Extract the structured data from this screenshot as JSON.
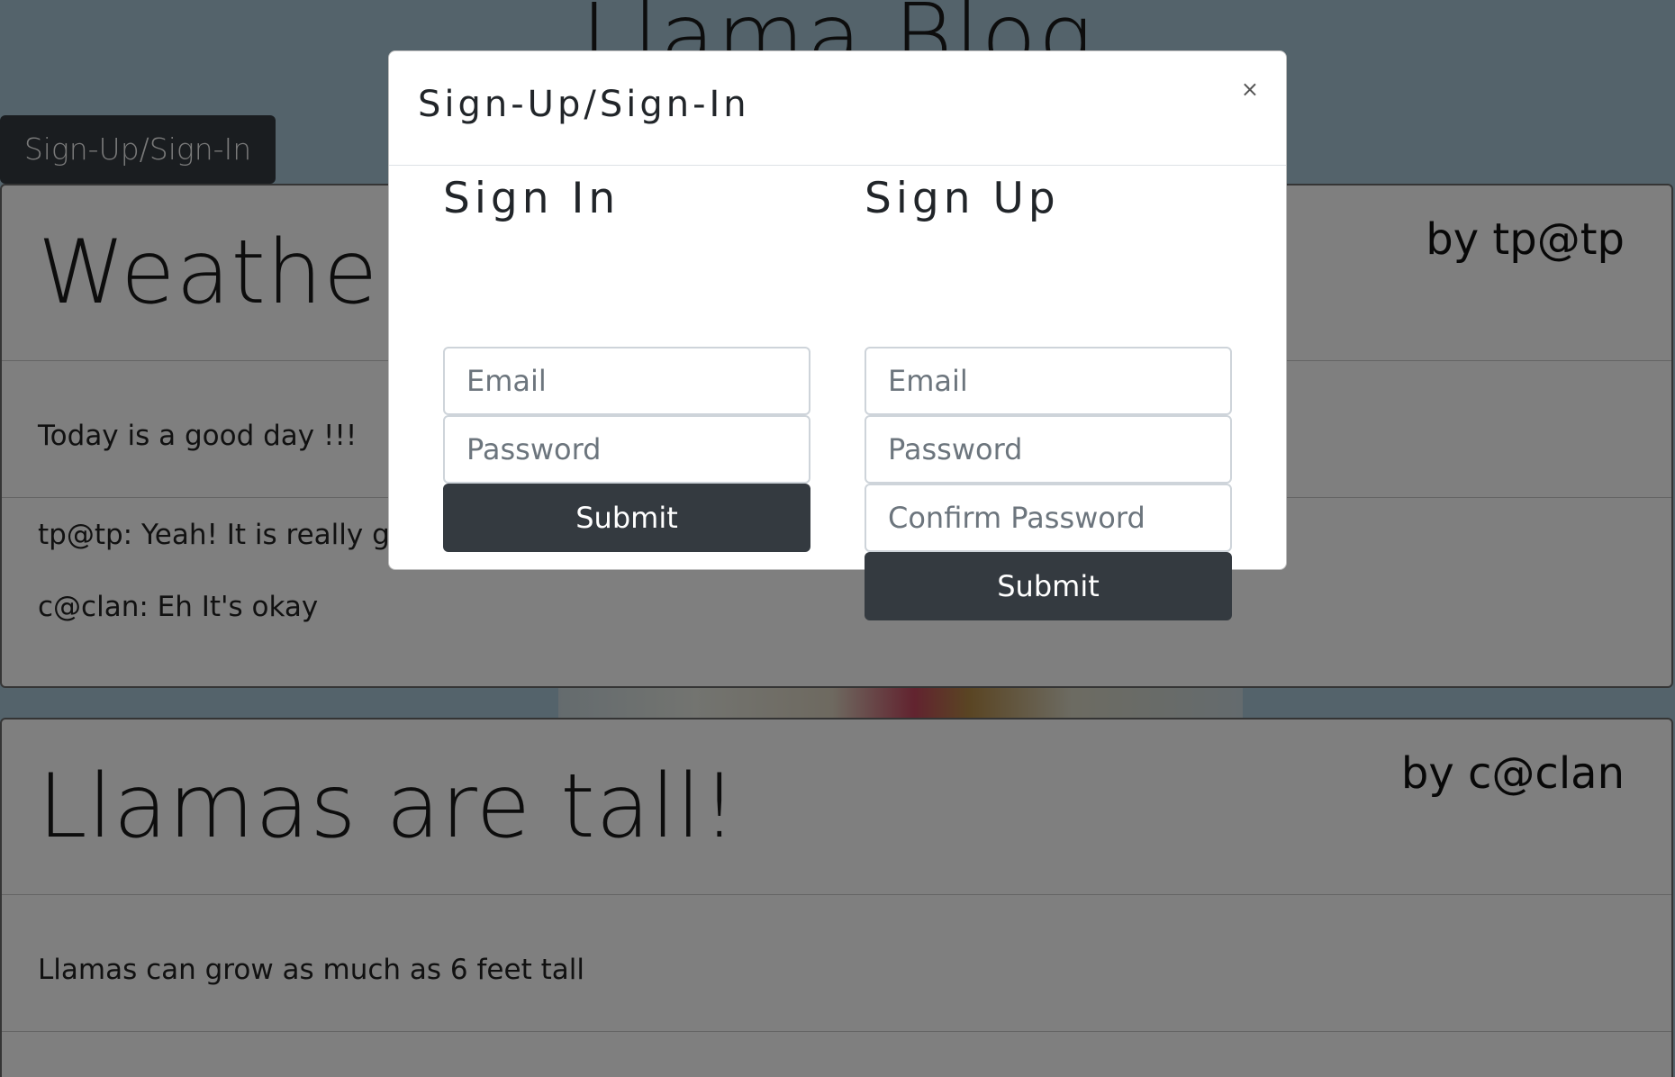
{
  "blog": {
    "title": "Llama Blog",
    "auth_button_label": "Sign-Up/Sign-In"
  },
  "posts": [
    {
      "title": "Weather",
      "author": "by tp@tp",
      "body": "Today is a good day !!!",
      "comments": [
        "tp@tp: Yeah! It is really g",
        "c@clan: Eh It's okay"
      ]
    },
    {
      "title": "Llamas are tall!",
      "author": "by c@clan",
      "body": "Llamas can grow as much as 6 feet tall"
    }
  ],
  "modal": {
    "title": "Sign-Up/Sign-In",
    "close_glyph": "×",
    "sign_in": {
      "heading": "Sign In",
      "email_placeholder": "Email",
      "password_placeholder": "Password",
      "submit_label": "Submit"
    },
    "sign_up": {
      "heading": "Sign Up",
      "email_placeholder": "Email",
      "password_placeholder": "Password",
      "confirm_placeholder": "Confirm Password",
      "submit_label": "Submit"
    }
  },
  "colors": {
    "dark_button": "#343a40",
    "backdrop": "rgba(0,0,0,0.5)"
  }
}
